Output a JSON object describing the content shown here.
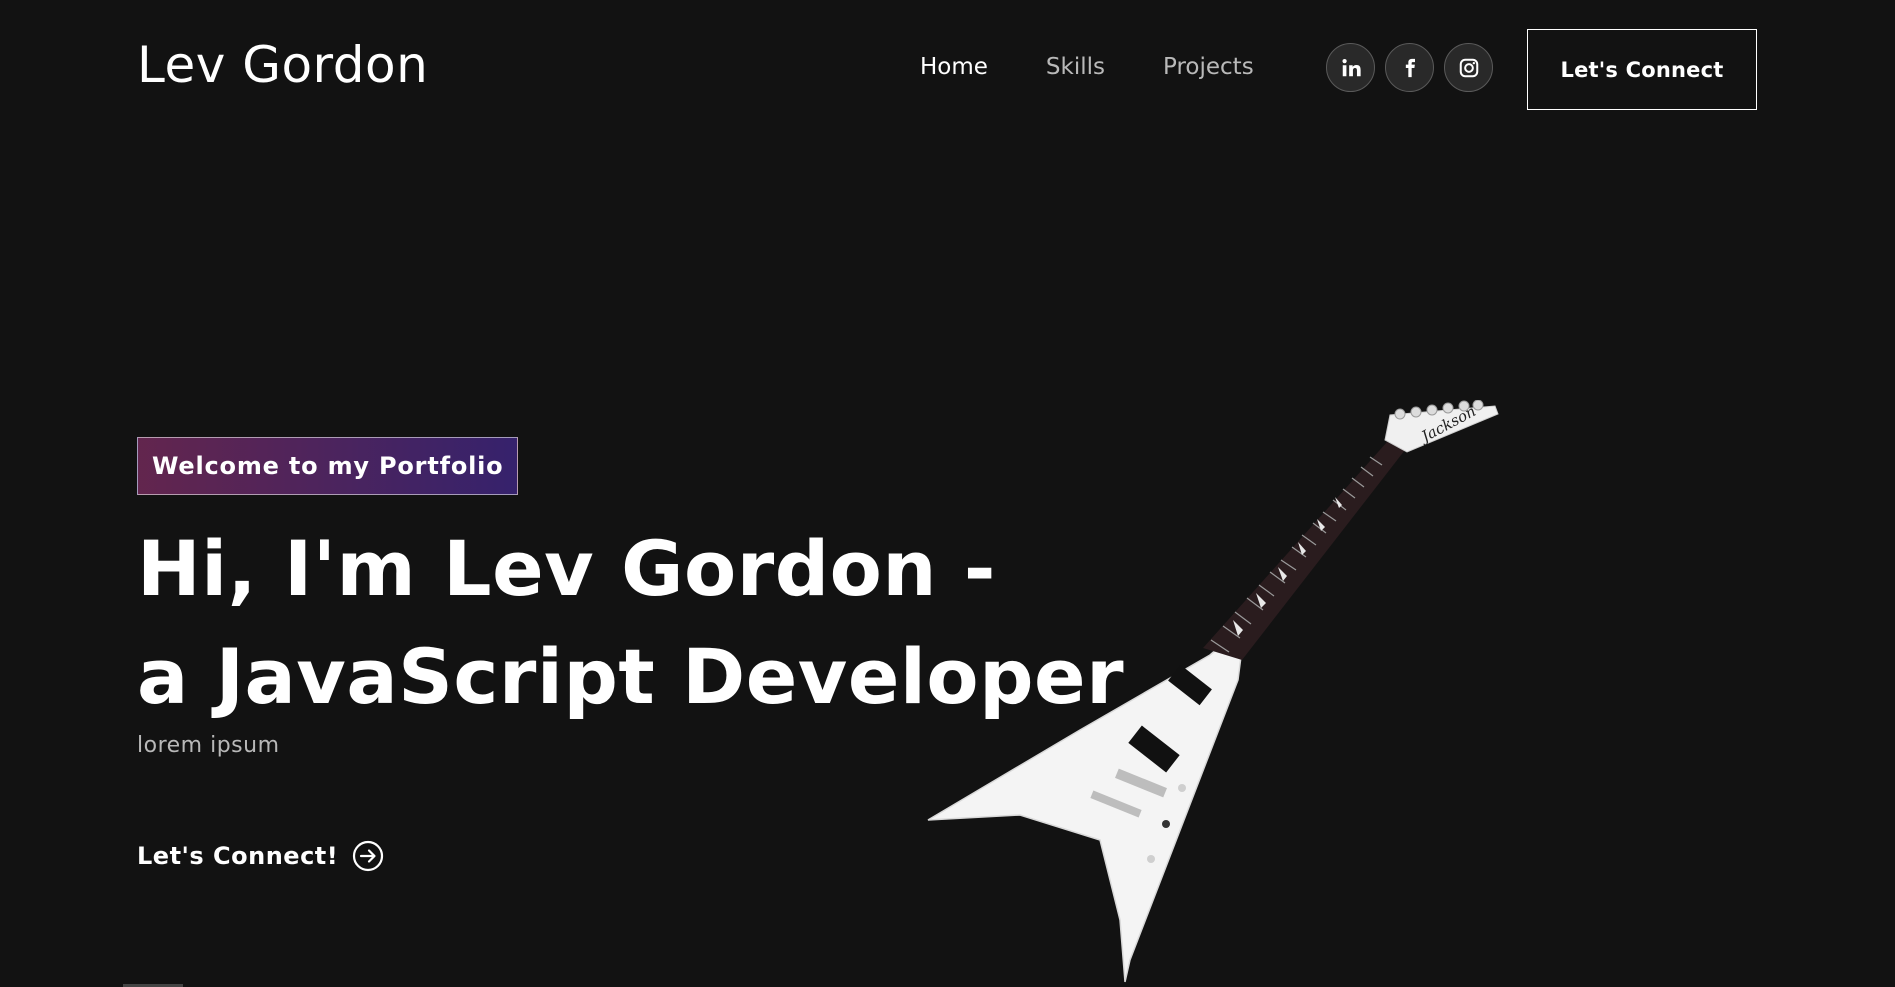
{
  "brand": {
    "name": "Lev Gordon"
  },
  "nav": {
    "links": [
      {
        "label": "Home",
        "active": true
      },
      {
        "label": "Skills",
        "active": false
      },
      {
        "label": "Projects",
        "active": false
      }
    ],
    "social": [
      {
        "icon": "linkedin-icon"
      },
      {
        "icon": "facebook-icon"
      },
      {
        "icon": "instagram-icon"
      }
    ],
    "connect_label": "Let's Connect"
  },
  "hero": {
    "tagline": "Welcome to my Portfolio",
    "headline_line1": "Hi, I'm Lev Gordon -",
    "headline_line2": "a JavaScript Developer",
    "subtext": "lorem ipsum",
    "cta_label": "Let's Connect!"
  },
  "guitar": {
    "headstock_logo": "Jackson"
  },
  "colors": {
    "background": "#121212",
    "tagline_gradient_start": "#aa367c",
    "tagline_gradient_end": "#4a2fbd",
    "text": "#ffffff"
  }
}
